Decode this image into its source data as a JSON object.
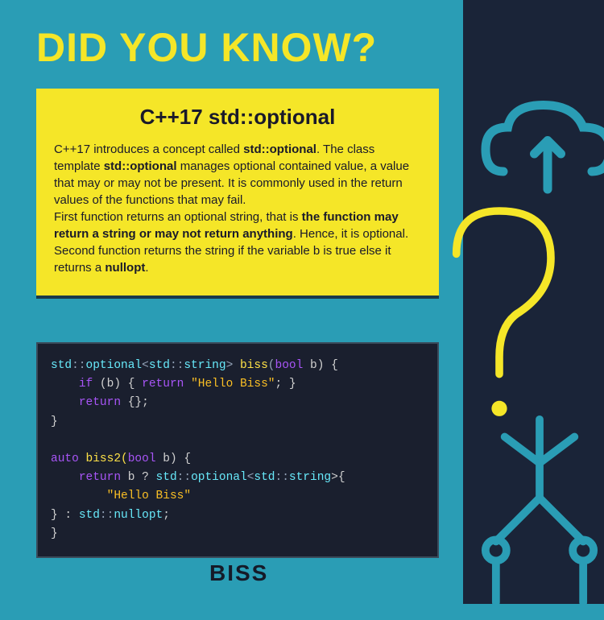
{
  "headline": "DID YOU KNOW?",
  "card": {
    "title": "C++17 std::optional",
    "p1a": "C++17 introduces a concept called ",
    "p1b": "std::optional",
    "p1c": ". The class template ",
    "p1d": "std::optional",
    "p1e": " manages optional contained value, a value that may or may not be present. It is commonly used in the return values of the functions that may fail.",
    "p2a": "First function returns an optional string, that is ",
    "p2b": "the function may return a string or may not return anything",
    "p2c": ". Hence, it is optional.",
    "p3a": "Second function returns the string if the variable b is true else it returns a ",
    "p3b": "nullopt",
    "p3c": "."
  },
  "code": {
    "l1_std": "std",
    "l1_opt": "optional",
    "l1_str": "string",
    "l1_fn": "biss",
    "l1_bool": "bool",
    "l1_b": " b) {",
    "l2_if": "if",
    "l2_b": " (b) { ",
    "l2_ret": "return",
    "l2_s": "\"Hello Biss\"",
    "l2_end": "; }",
    "l3_ret": "return",
    "l3_end": " {};",
    "l4": "}",
    "l6_auto": "auto",
    "l6_fn": " biss2(",
    "l6_bool": "bool",
    "l6_b": " b) {",
    "l7_ret": "return",
    "l7_b": " b ? ",
    "l7_std": "std",
    "l7_opt": "optional",
    "l7_str": "string",
    "l7_end": ">{",
    "l8_s": "\"Hello Biss\"",
    "l9_a": "    } : ",
    "l9_std": "std",
    "l9_null": "nullopt",
    "l9_end": ";",
    "l10": "}"
  },
  "footer": "BISS",
  "icons": {
    "cloud": "cloud-upload-icon",
    "question": "question-mark-icon",
    "circuit": "circuit-icon"
  },
  "colors": {
    "bg": "#2a9db5",
    "yellow": "#f5e628",
    "dark": "#1a2438"
  }
}
